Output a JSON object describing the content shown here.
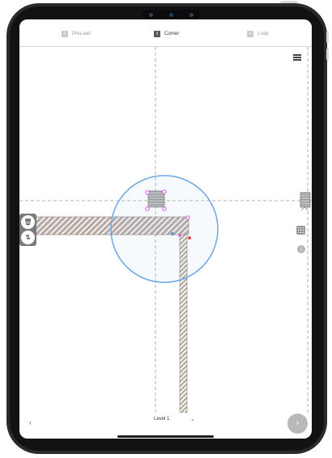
{
  "steps": [
    {
      "num": "2",
      "label": "PreLoad",
      "state": "inactive"
    },
    {
      "num": "3",
      "label": "Corner",
      "state": "active"
    },
    {
      "num": "4",
      "label": "Load",
      "state": "inactive"
    }
  ],
  "icons": {
    "menu": "hamburger-menu-icon",
    "left_tool_1": "trash-icon",
    "left_tool_2": "flip-icon",
    "right_1": "wall-stack-icon",
    "right_2": "grid-icon",
    "right_3": "info-icon",
    "back": "chevron-left-icon",
    "next": "chevron-right-icon",
    "level_dropdown": "chevron-down-icon"
  },
  "bottom": {
    "back_glyph": "‹",
    "level_label": "Level 1",
    "level_chevron": "⌄",
    "next_glyph": "›"
  },
  "tools": {
    "trash_glyph": "🗑",
    "flip_glyph": "⇅",
    "info_glyph": "i"
  },
  "colors": {
    "wall_fill": "#b8aaa5",
    "wall_stripe": "#ffffff",
    "selection_circle": "#6fa7e6",
    "handle": "#e05be0",
    "guide_line": "#9a9a9a",
    "active_step": "#555555",
    "next_button": "#b9b9b9"
  }
}
